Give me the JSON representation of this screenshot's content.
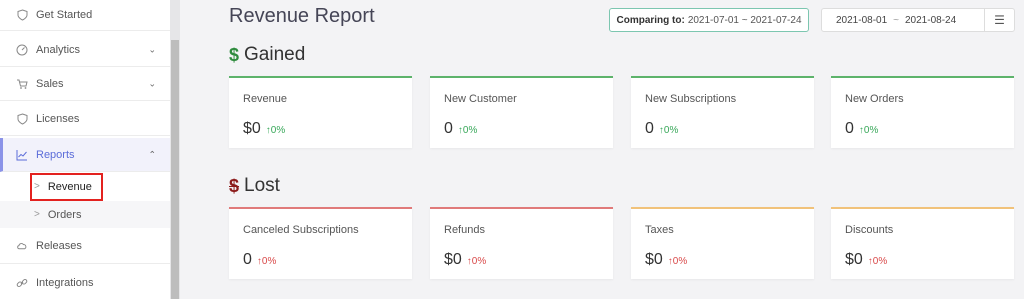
{
  "sidebar": {
    "items": [
      {
        "label": "Get Started",
        "icon": "shield-icon"
      },
      {
        "label": "Analytics",
        "icon": "gauge-icon"
      },
      {
        "label": "Sales",
        "icon": "cart-icon"
      },
      {
        "label": "Licenses",
        "icon": "shield-icon"
      },
      {
        "label": "Reports",
        "icon": "chart-icon"
      },
      {
        "label": "Releases",
        "icon": "cloud-icon"
      },
      {
        "label": "Integrations",
        "icon": "link-icon"
      }
    ],
    "sub_items": [
      {
        "label": "Revenue"
      },
      {
        "label": "Orders"
      }
    ]
  },
  "header": {
    "title": "Revenue Report",
    "compare_label": "Comparing to:",
    "compare_range": "2021-07-01 ~ 2021-07-24",
    "date_from": "2021-08-01",
    "date_sep": "~",
    "date_to": "2021-08-24"
  },
  "sections": {
    "gained": {
      "title": "Gained",
      "symbol": "$",
      "cards": [
        {
          "label": "Revenue",
          "value": "$0",
          "delta": "0%"
        },
        {
          "label": "New Customer",
          "value": "0",
          "delta": "0%"
        },
        {
          "label": "New Subscriptions",
          "value": "0",
          "delta": "0%"
        },
        {
          "label": "New Orders",
          "value": "0",
          "delta": "0%"
        }
      ]
    },
    "lost": {
      "title": "Lost",
      "symbol": "$",
      "cards": [
        {
          "label": "Canceled Subscriptions",
          "value": "0",
          "delta": "0%"
        },
        {
          "label": "Refunds",
          "value": "$0",
          "delta": "0%"
        },
        {
          "label": "Taxes",
          "value": "$0",
          "delta": "0%"
        },
        {
          "label": "Discounts",
          "value": "$0",
          "delta": "0%"
        }
      ]
    }
  },
  "colors": {
    "accent": "#5b6cd9",
    "positive": "#39a85a",
    "negative": "#d94a4a",
    "highlight_box": "#e3221f"
  }
}
